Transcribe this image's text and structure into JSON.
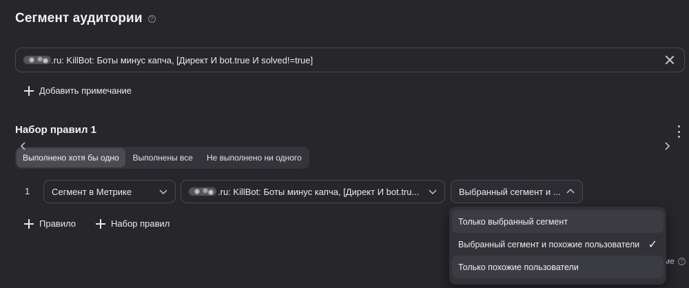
{
  "header": {
    "title": "Сегмент аудитории",
    "help_icon": "?"
  },
  "segment": {
    "value": ".ru: KillBot: Боты минус капча, [Директ И bot.true И solved!=true]"
  },
  "note": {
    "add_label": "Добавить примечание"
  },
  "ruleset": {
    "title": "Набор правил 1",
    "modes": [
      "Выполнено хотя бы одно",
      "Выполнены все",
      "Не выполнено ни одного"
    ],
    "active_mode": "Выполнено хотя бы одно"
  },
  "rule": {
    "number": "1",
    "source_select": "Сегмент в Метрике",
    "segment_select": ".ru: KillBot: Боты минус капча, [Директ И bot.tru...",
    "audience_select": "Выбранный сегмент и ..."
  },
  "actions": {
    "add_rule": "Правило",
    "add_ruleset": "Набор правил"
  },
  "dropdown": {
    "options": [
      {
        "label": "Только выбранный сегмент",
        "selected": false
      },
      {
        "label": "Выбранный сегмент и похожие пользователи",
        "selected": true
      },
      {
        "label": "Только похожие пользователи",
        "selected": false
      }
    ],
    "check_glyph": "✓"
  },
  "peek": {
    "text": "ме",
    "help_icon": "?"
  },
  "colors": {
    "background": "#26262b",
    "surface": "#313137",
    "border": "#4a4a50",
    "text": "#ececee"
  }
}
